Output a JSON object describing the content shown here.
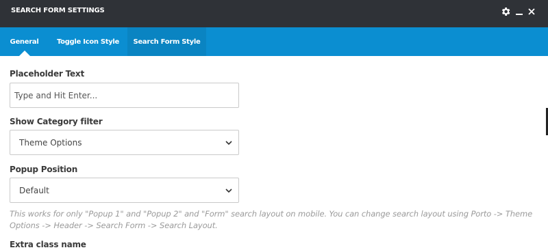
{
  "dialog": {
    "title": "SEARCH FORM SETTINGS",
    "controls": [
      "gear-icon",
      "minimize-icon",
      "close-icon"
    ]
  },
  "tabs": [
    {
      "label": "General",
      "active": true
    },
    {
      "label": "Toggle Icon Style",
      "active": false
    },
    {
      "label": "Search Form Style",
      "active": false
    }
  ],
  "fields": {
    "placeholder_text": {
      "label": "Placeholder Text",
      "value": "",
      "placeholder": "Type and Hit Enter..."
    },
    "category_filter": {
      "label": "Show Category filter",
      "selected": "Theme Options"
    },
    "popup_position": {
      "label": "Popup Position",
      "selected": "Default"
    },
    "help_text": "This works for only \"Popup 1\" and \"Popup 2\" and \"Form\" search layout on mobile. You can change search layout using Porto -> Theme Options -> Header -> Search Form -> Search Layout.",
    "extra_class": {
      "label": "Extra class name"
    }
  },
  "colors": {
    "titlebar": "#2f3237",
    "tabbar": "#0b8ed1",
    "help_text": "#9a9a9a"
  }
}
